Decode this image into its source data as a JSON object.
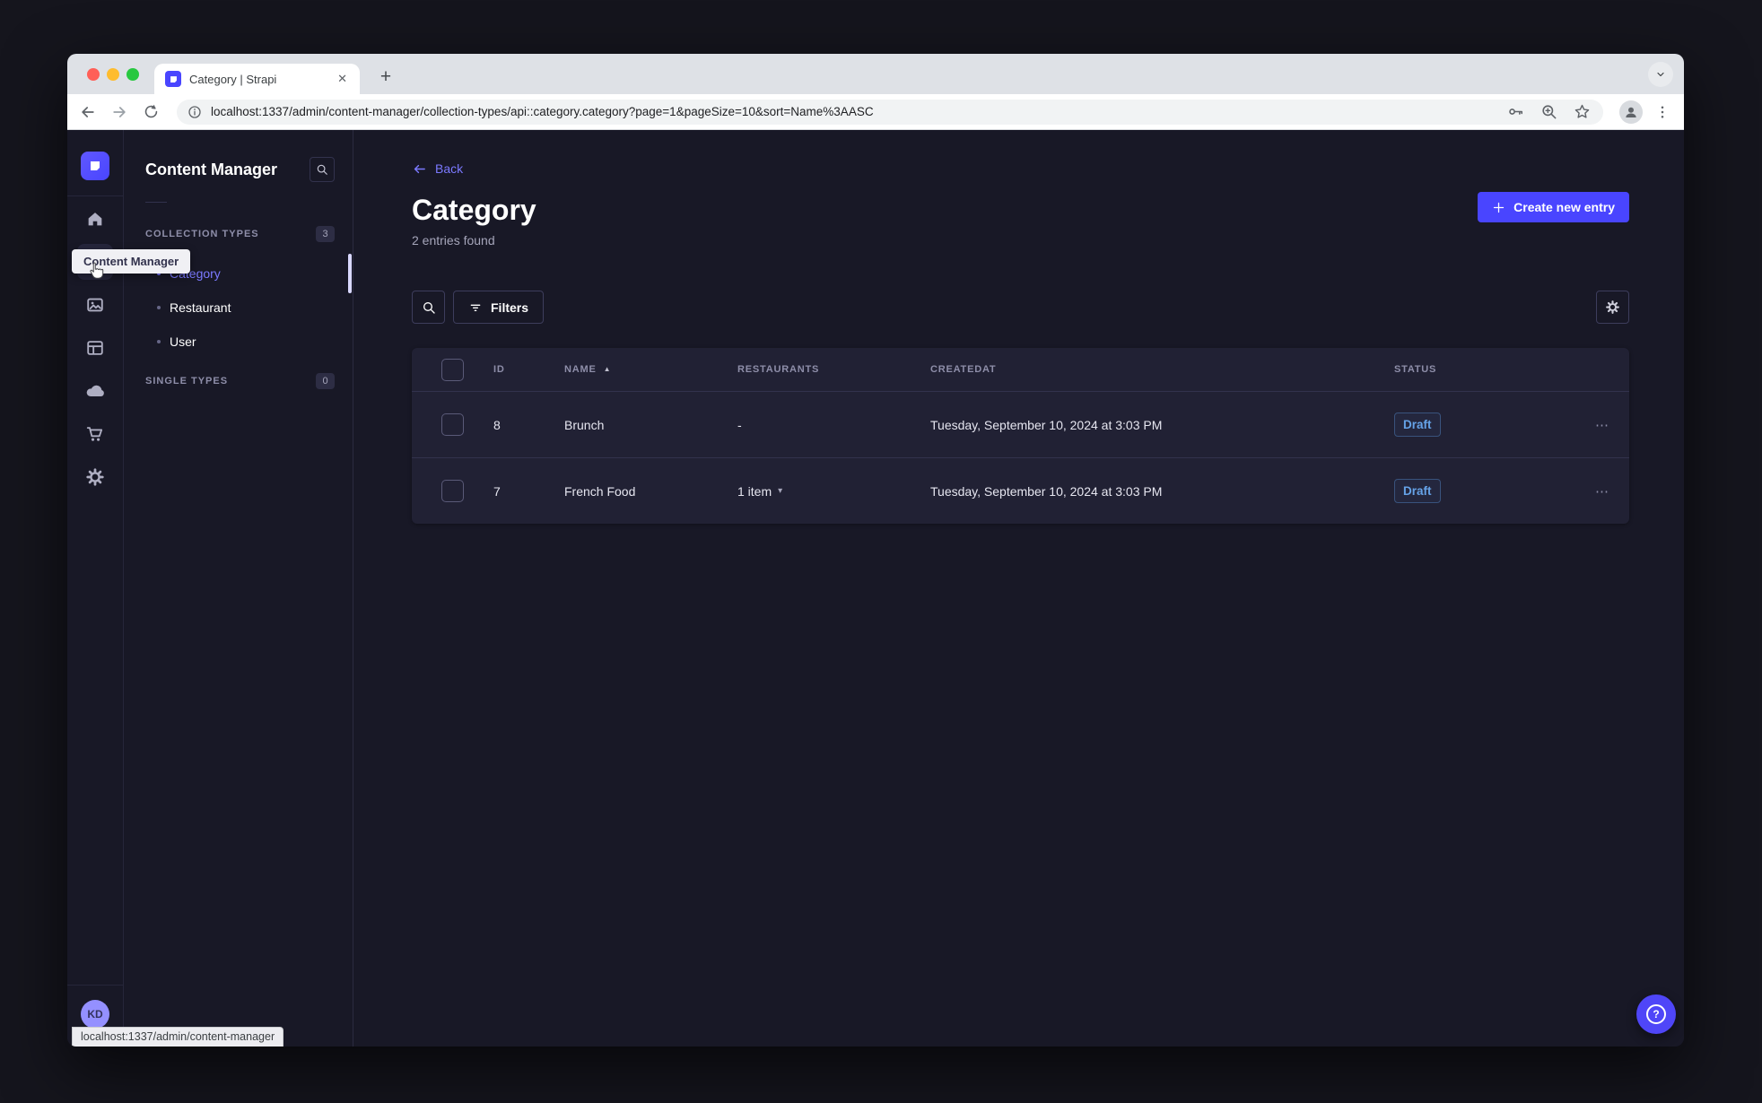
{
  "browser": {
    "tab_title": "Category | Strapi",
    "url": "localhost:1337/admin/content-manager/collection-types/api::category.category?page=1&pageSize=10&sort=Name%3AASC",
    "status_link_preview": "localhost:1337/admin/content-manager"
  },
  "icons": {
    "close_tab": "✕",
    "new_tab": "+",
    "more_actions": "⋯",
    "caret_down": "▾",
    "sort_asc": "▲",
    "question": "?"
  },
  "sidebar": {
    "title": "Content Manager",
    "tooltip": "Content Manager",
    "sections": [
      {
        "label": "COLLECTION TYPES",
        "badge": "3"
      },
      {
        "label": "SINGLE TYPES",
        "badge": "0"
      }
    ],
    "items": [
      {
        "label": "Category",
        "active": true
      },
      {
        "label": "Restaurant",
        "active": false
      },
      {
        "label": "User",
        "active": false
      }
    ]
  },
  "user": {
    "initials": "KD"
  },
  "main": {
    "back": "Back",
    "title": "Category",
    "subtitle": "2 entries found",
    "create_button": "Create new entry",
    "filters": "Filters",
    "table": {
      "headers": [
        "ID",
        "NAME",
        "RESTAURANTS",
        "CREATEDAT",
        "STATUS"
      ],
      "rows": [
        {
          "id": "8",
          "name": "Brunch",
          "restaurants": "-",
          "createdAt": "Tuesday, September 10, 2024 at 3:03 PM",
          "status": "Draft"
        },
        {
          "id": "7",
          "name": "French Food",
          "restaurants": "1 item",
          "createdAt": "Tuesday, September 10, 2024 at 3:03 PM",
          "status": "Draft"
        }
      ]
    }
  },
  "colors": {
    "primary": "#4945ff",
    "primary_light": "#7b79ff",
    "app_bg": "#181826",
    "surface": "#212134",
    "border": "#32324d",
    "text_muted": "#a5a5ba",
    "draft_text": "#66a3e8"
  }
}
